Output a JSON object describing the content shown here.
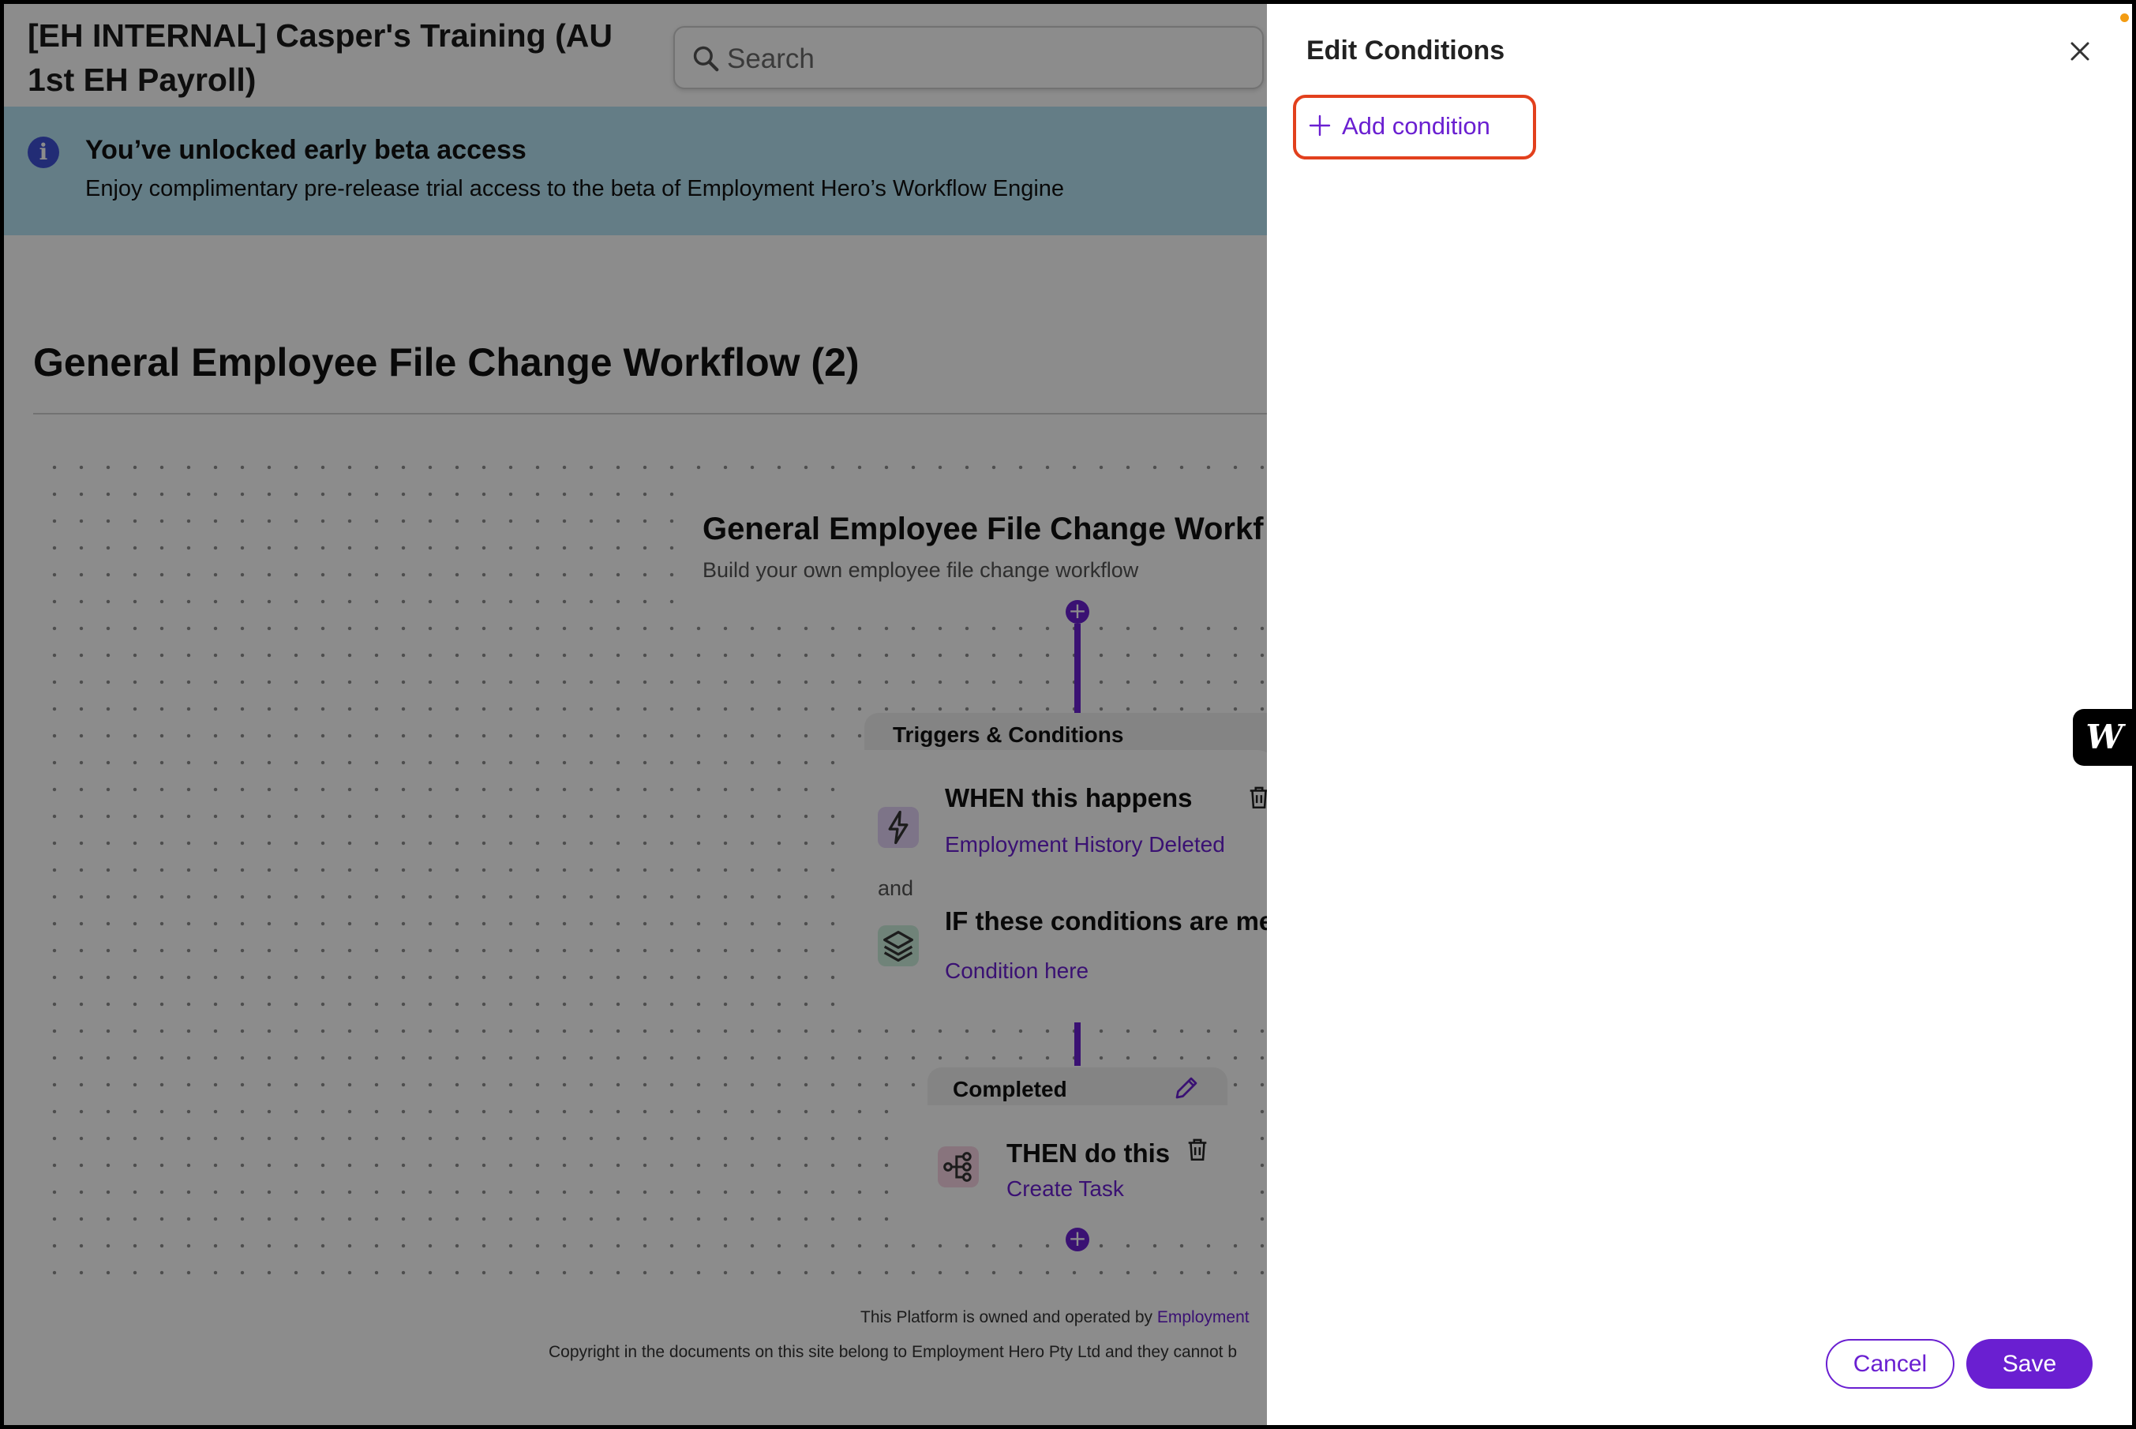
{
  "header": {
    "org_title": "[EH INTERNAL] Casper's Training (AU 1st EH Payroll)",
    "search_placeholder": "Search"
  },
  "banner": {
    "title": "You’ve unlocked early beta access",
    "text": "Enjoy complimentary pre-release trial access to the beta of Employment Hero’s Workflow Engine",
    "icon": "i"
  },
  "page": {
    "title": "General Employee File Change Workflow (2)"
  },
  "workflow_card": {
    "title": "General Employee File Change Workf",
    "description": "Build your own employee file change workflow"
  },
  "triggers": {
    "tab_label": "Triggers & Conditions",
    "when_title": "WHEN this happens",
    "when_value": "Employment History Deleted",
    "and_label": "and",
    "if_title": "IF these conditions are met",
    "if_value": "Condition here"
  },
  "completed": {
    "tab_label": "Completed",
    "then_title": "THEN do this",
    "then_value": "Create Task"
  },
  "footer": {
    "line1_prefix": "This Platform is owned and operated by ",
    "line1_link": "Employment",
    "line2": "Copyright in the documents on this site belong to Employment Hero Pty Ltd and they cannot b"
  },
  "drawer": {
    "title": "Edit Conditions",
    "add_condition_label": "Add condition",
    "cancel_label": "Cancel",
    "save_label": "Save"
  },
  "widget": {
    "label": "W"
  },
  "colors": {
    "accent": "#6a1fd1",
    "banner": "#b7e4f5",
    "highlight": "#e2401d",
    "info": "#3f51d6"
  },
  "icons": [
    "search-icon",
    "info-icon",
    "plus-icon",
    "lightning-icon",
    "layers-icon",
    "trash-icon",
    "pencil-icon",
    "branch-icon",
    "close-icon"
  ]
}
